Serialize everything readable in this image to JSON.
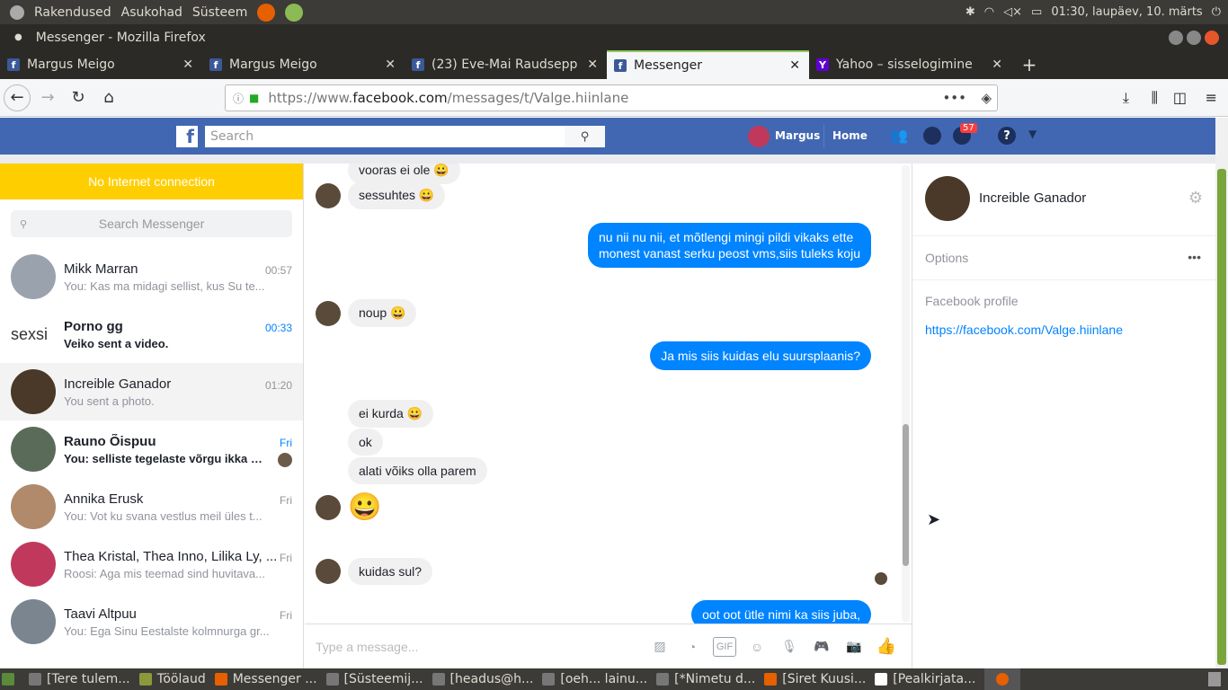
{
  "os": {
    "menus": [
      "Rakendused",
      "Asukohad",
      "Süsteem"
    ],
    "clock": "01:30, laupäev, 10. märts"
  },
  "window": {
    "title": "Messenger - Mozilla Firefox"
  },
  "tabs": [
    {
      "label": "Margus Meigo"
    },
    {
      "label": "Margus Meigo"
    },
    {
      "label": "(23) Eve-Mai Raudsepp"
    },
    {
      "label": "Messenger"
    },
    {
      "label": "Yahoo – sisselogimine"
    }
  ],
  "url": {
    "prefix": "https://www.",
    "domain": "facebook.com",
    "path": "/messages/t/Valge.hiinlane"
  },
  "fb": {
    "search_placeholder": "Search",
    "user": "Margus",
    "home": "Home",
    "notif_count": "57"
  },
  "left": {
    "banner": "No Internet connection",
    "search_placeholder": "Search Messenger",
    "conversations": [
      {
        "name": "Mikk Marran",
        "snippet": "You: Kas ma midagi sellist, kus Su te...",
        "time": "00:57"
      },
      {
        "name": "Porno gg",
        "snippet": "Veiko sent a video.",
        "time": "00:33",
        "avatar_text": "sexsi"
      },
      {
        "name": "Increible Ganador",
        "snippet": "You sent a photo.",
        "time": "01:20"
      },
      {
        "name": "Rauno Õispuu",
        "snippet": "You: selliste tegelaste võrgu ikka p...",
        "time": "Fri"
      },
      {
        "name": "Annika Erusk",
        "snippet": "You: Vot ku svana vestlus meil üles t...",
        "time": "Fri"
      },
      {
        "name": "Thea Kristal, Thea Inno, Lilika Ly, ...",
        "snippet": "Roosi: Aga mis teemad sind huvitava...",
        "time": "Fri"
      },
      {
        "name": "Taavi Altpuu",
        "snippet": "You: Ega Sinu Eestalste kolmnurga gr...",
        "time": "Fri"
      }
    ]
  },
  "chat": {
    "messages": [
      {
        "text": "vooras ei ole 😀"
      },
      {
        "text": "sessuhtes 😀"
      },
      {
        "text": "nu nii nu nii, et mõtlengi mingi pildi vikaks ette"
      },
      {
        "text": "monest vanast serku peost vms,siis tuleks koju"
      },
      {
        "text": "noup 😀"
      },
      {
        "text": "Ja mis siis kuidas elu suursplaanis?"
      },
      {
        "text": "ei kurda 😀"
      },
      {
        "text": "ok"
      },
      {
        "text": "alati võiks olla parem"
      },
      {
        "text": "😀"
      },
      {
        "text": "kuidas sul?"
      },
      {
        "text": "oot oot ütle nimi ka siis juba,"
      }
    ],
    "composer_placeholder": "Type a message..."
  },
  "right": {
    "name": "Increible Ganador",
    "options": "Options",
    "profile_label": "Facebook profile",
    "profile_link": "https://facebook.com/Valge.hiinlane"
  },
  "taskbar": [
    "[Tere tulem...",
    "Töölaud",
    "Messenger ...",
    "[Süsteemij...",
    "[headus@h...",
    "[oeh... lainu...",
    "[*Nimetu d...",
    "[Siret Kuusi...",
    "[Pealkirjata..."
  ]
}
